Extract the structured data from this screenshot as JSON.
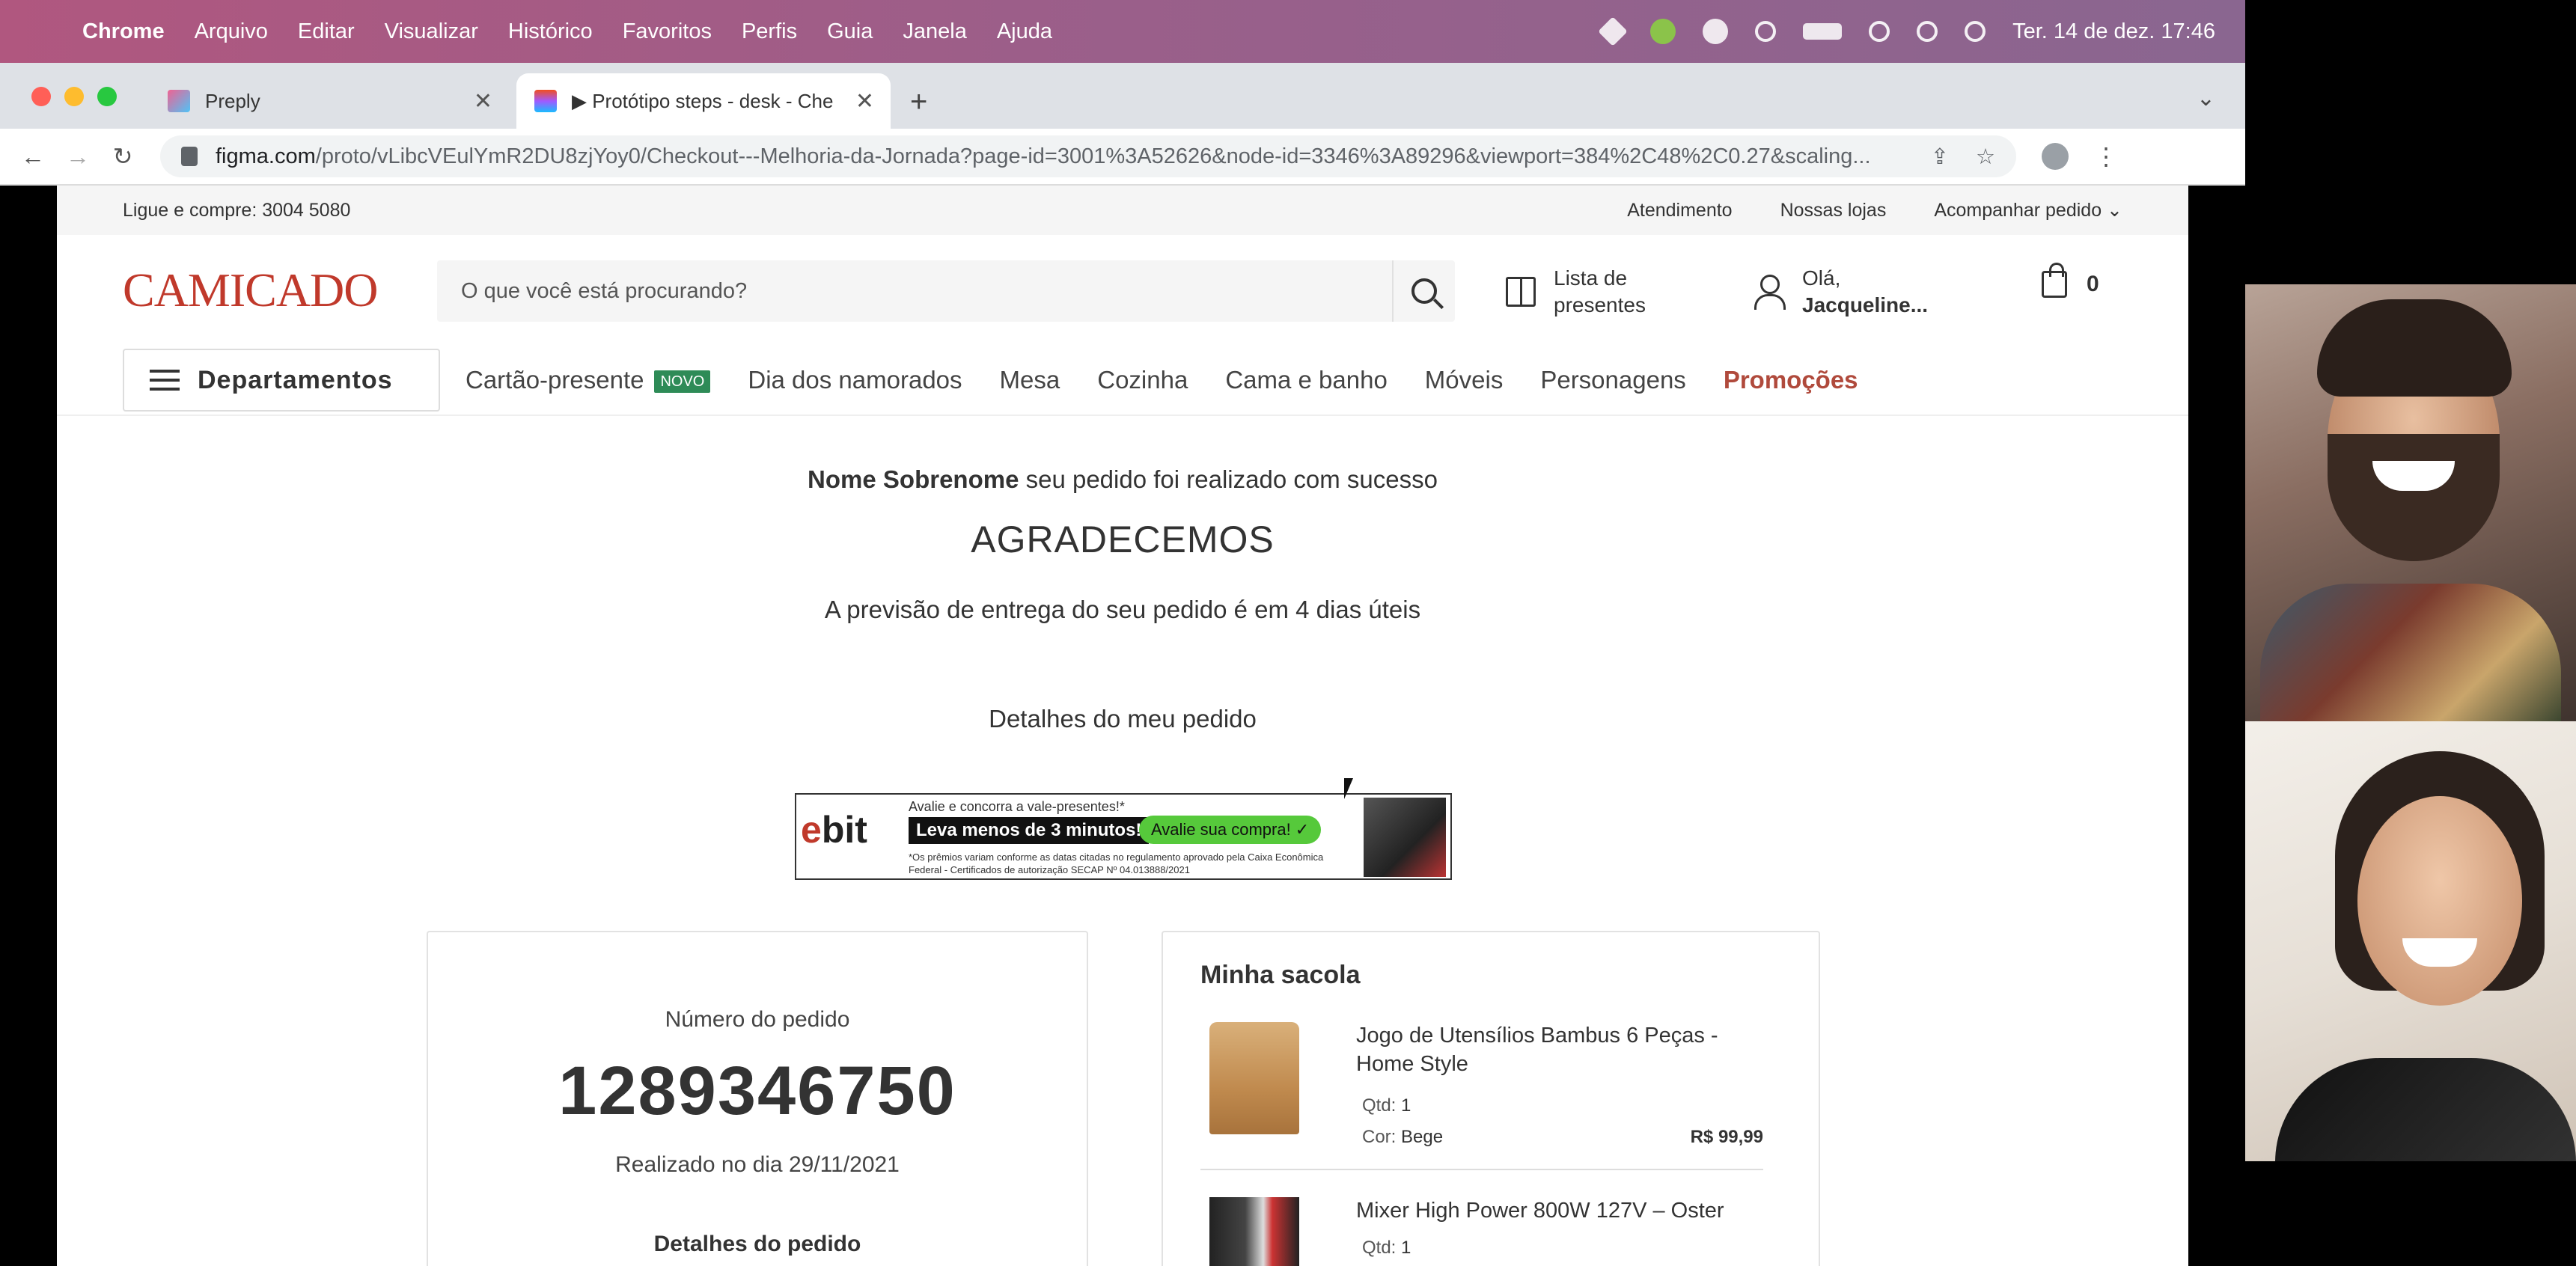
{
  "menubar": {
    "app": "Chrome",
    "items": [
      "Arquivo",
      "Editar",
      "Visualizar",
      "Histórico",
      "Favoritos",
      "Perfis",
      "Guia",
      "Janela",
      "Ajuda"
    ],
    "datetime": "Ter. 14 de dez.  17:46"
  },
  "tabs": [
    {
      "title": "Preply",
      "close": "✕"
    },
    {
      "title": "▶ Protótipo steps - desk - Che",
      "close": "✕"
    }
  ],
  "new_tab": "+",
  "tab_menu": "⌄",
  "address": {
    "host": "figma.com",
    "path": "/proto/vLibcVEulYmR2DU8zjYoy0/Checkout---Melhoria-da-Jornada?page-id=3001%3A52626&node-id=3346%3A89296&viewport=384%2C48%2C0.27&scaling..."
  },
  "nav_buttons": {
    "back": "←",
    "forward": "→",
    "reload": "↻",
    "share": "⇪",
    "star": "☆",
    "menu": "⋮"
  },
  "site": {
    "topbar": {
      "phone": "Ligue e compre: 3004 5080",
      "links": [
        "Atendimento",
        "Nossas lojas",
        "Acompanhar pedido ⌄"
      ]
    },
    "logo": "CAMICADO",
    "search_placeholder": "O que você está procurando?",
    "gift_list": {
      "line1": "Lista de",
      "line2": "presentes"
    },
    "user": {
      "greeting": "Olá,",
      "name": "Jacqueline..."
    },
    "cart_count": "0",
    "departments": "Departamentos",
    "nav_items": [
      "Cartão-presente",
      "Dia dos namorados",
      "Mesa",
      "Cozinha",
      "Cama e banho",
      "Móveis",
      "Personagens"
    ],
    "nav_badge": "NOVO",
    "promo": "Promoções",
    "confirmation": {
      "name": "Nome Sobrenome",
      "message": " seu pedido foi realizado com sucesso",
      "thanks": "AGRADECEMOS",
      "forecast": "A previsão de entrega do seu pedido é em 4 dias úteis",
      "details_link": "Detalhes do meu pedido"
    },
    "ebit_banner": {
      "logo_e": "e",
      "logo_rest": "bit",
      "top": "Avalie e concorra a vale-presentes!*",
      "headline": "Leva menos de 3 minutos!",
      "cta": "Avalie sua compra! ✓",
      "fine_print": "*Os prêmios variam conforme as datas citadas no regulamento aprovado pela Caixa Econômica Federal - Certificados de autorização SECAP Nº 04.013888/2021"
    },
    "order": {
      "label": "Número do pedido",
      "number": "1289346750",
      "date": "Realizado no dia 29/11/2021",
      "details": "Detalhes do pedido"
    },
    "bag": {
      "title": "Minha sacola",
      "products": [
        {
          "name": "Jogo de Utensílios Bambus 6 Peças - Home Style",
          "qty_label": "Qtd:",
          "qty": "1",
          "color_label": "Cor:",
          "color": "Bege",
          "price": "R$ 99,99"
        },
        {
          "name": "Mixer High Power 800W 127V – Oster",
          "qty_label": "Qtd:",
          "qty": "1"
        }
      ]
    }
  }
}
